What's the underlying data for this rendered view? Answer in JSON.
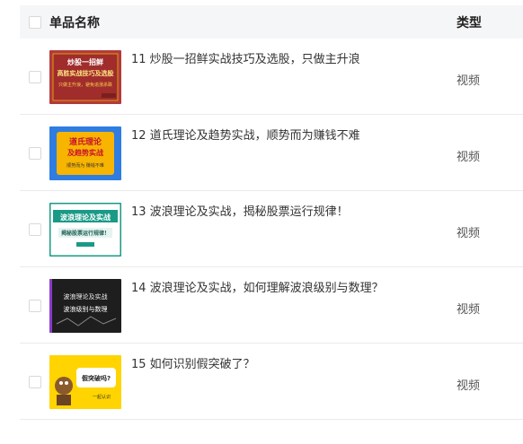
{
  "header": {
    "name_col": "单品名称",
    "type_col": "类型"
  },
  "rows": [
    {
      "title": "11 炒股一招鲜实战技巧及选股，只做主升浪",
      "type": "视频",
      "thumb": {
        "line1": "炒股一招鲜",
        "line2": "高胜实战技巧及选股",
        "line3": "只做主升浪，避免追涨杀跌",
        "bg": "#b33a3a"
      }
    },
    {
      "title": "12 道氏理论及趋势实战，顺势而为赚钱不难",
      "type": "视频",
      "thumb": {
        "line1": "道氏理论",
        "line2": "及趋势实战",
        "line3": "顺势而为  赚钱不难",
        "bg": "#2f7de1"
      }
    },
    {
      "title": "13 波浪理论及实战，揭秘股票运行规律！",
      "type": "视频",
      "thumb": {
        "line1": "波浪理论及实战",
        "line2": "揭秘股票运行规律！",
        "line3": "",
        "bg": "#1a9a86"
      }
    },
    {
      "title": "14 波浪理论及实战，如何理解波浪级别与数理？",
      "type": "视频",
      "thumb": {
        "line1": "波浪理论及实战",
        "line2": "波浪级别与数理",
        "line3": "",
        "bg": "#1e1e1e"
      }
    },
    {
      "title": "15 如何识别假突破了？",
      "type": "视频",
      "thumb": {
        "line1": "假突破吗?",
        "line2": "一起认识",
        "line3": "",
        "bg": "#ffd400"
      }
    }
  ]
}
